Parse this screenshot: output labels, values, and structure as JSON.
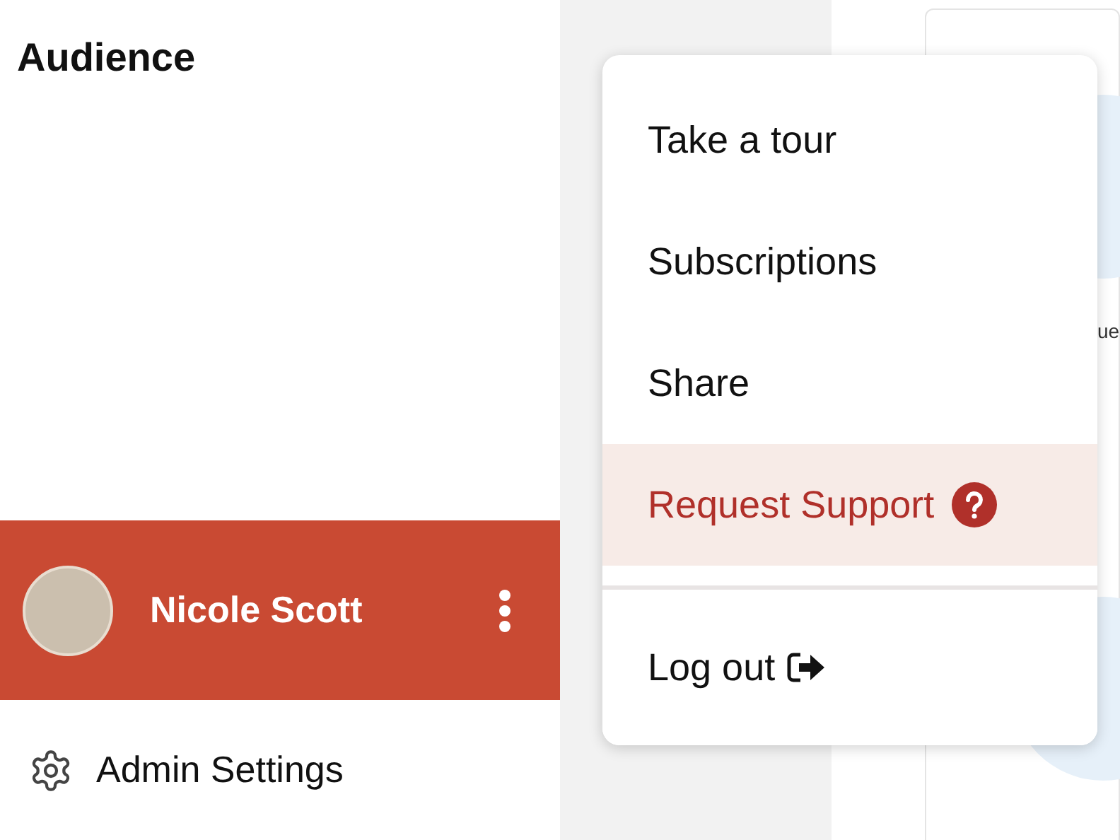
{
  "sidebar": {
    "title": "Audience",
    "user": {
      "name": "Nicole Scott"
    },
    "footer_link": {
      "label": "Admin Settings"
    }
  },
  "background": {
    "partial_text": "ue"
  },
  "menu": {
    "items": [
      {
        "label": "Take a tour",
        "kind": "plain",
        "highlighted": false
      },
      {
        "label": "Subscriptions",
        "kind": "plain",
        "highlighted": false
      },
      {
        "label": "Share",
        "kind": "plain",
        "highlighted": false
      },
      {
        "label": "Request Support",
        "kind": "help",
        "highlighted": true
      },
      {
        "label": "Log out",
        "kind": "logout",
        "highlighted": false
      }
    ]
  }
}
